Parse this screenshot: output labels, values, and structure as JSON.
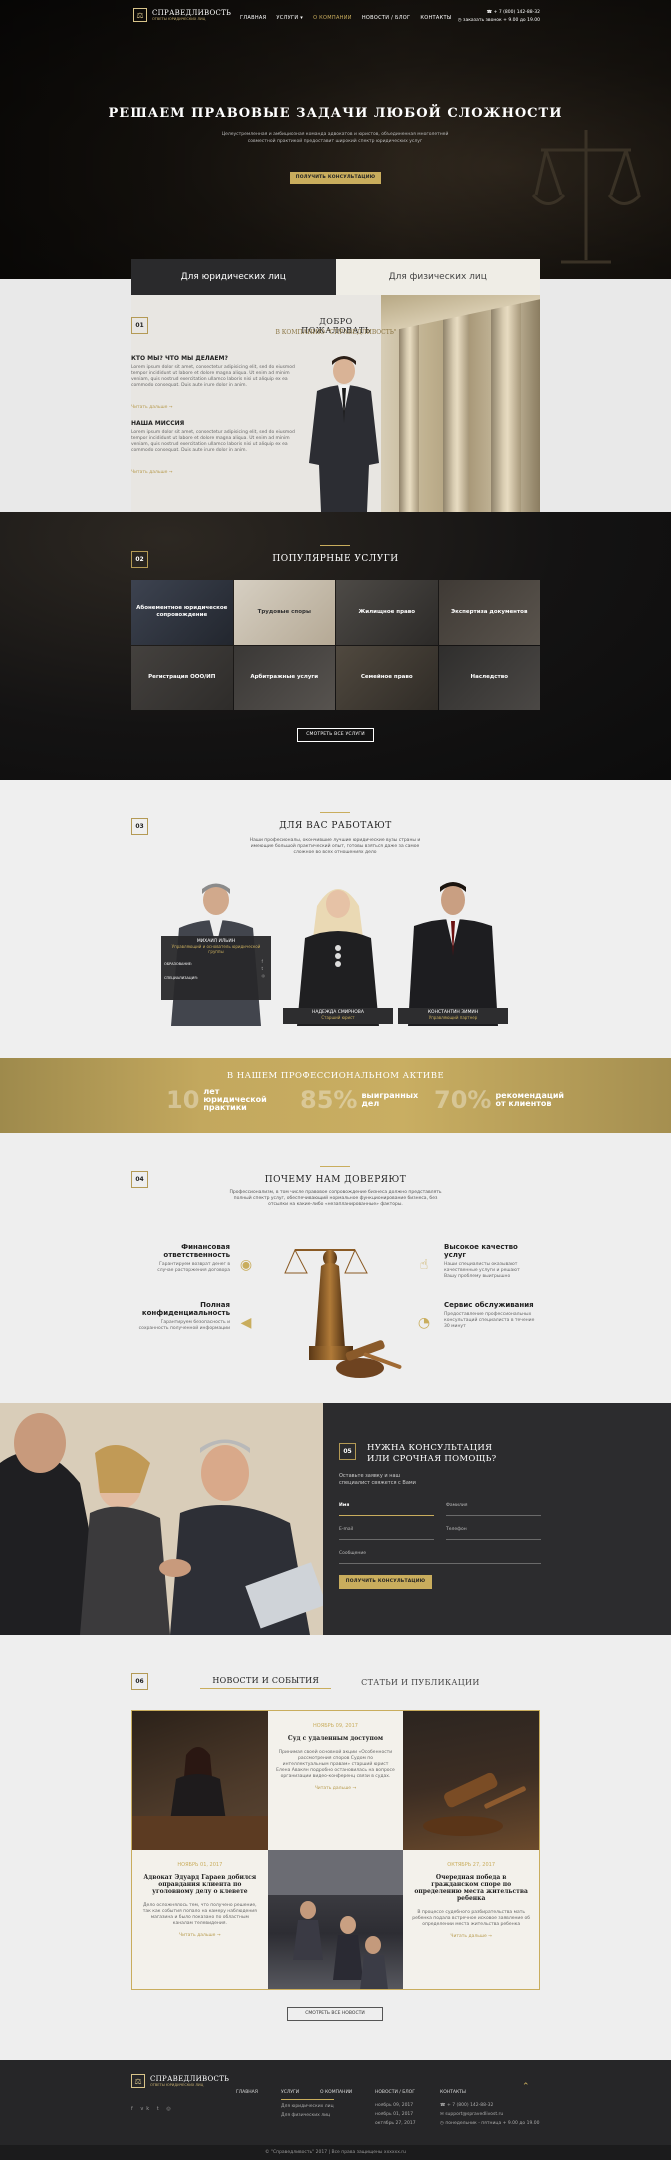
{
  "header": {
    "logo_title": "СПРАВЕДЛИВОСТЬ",
    "logo_subtitle": "ОТВЕТЫ ЮРИДИЧЕСКИХ ЛИЦ",
    "nav": [
      "ГЛАВНАЯ",
      "УСЛУГИ",
      "О КОМПАНИИ",
      "НОВОСТИ / БЛОГ",
      "КОНТАКТЫ"
    ],
    "phone": "+ 7 (800) 142-88-32",
    "hours": "заказать звонок + 9.00 до 19.00"
  },
  "hero": {
    "title": "РЕШАЕМ ПРАВОВЫЕ ЗАДАЧИ ЛЮБОЙ СЛОЖНОСТИ",
    "subtitle": "Целеустремленная и амбициозная команда адвокатов и юристов, объединенная многолетней совместной практикой предоставит широкий спектр юридических услуг",
    "cta": "ПОЛУЧИТЬ КОНСУЛЬТАЦИЮ"
  },
  "tabs": [
    "Для юридических лиц",
    "Для физических лиц"
  ],
  "welcome": {
    "num": "01",
    "title": "ДОБРО ПОЖАЛОВАТЬ",
    "subtitle": "В КОМПАНИЮ \"СПРАВЕДЛИВОСТЬ\"",
    "h1": "КТО МЫ? ЧТО МЫ ДЕЛАЕМ?",
    "p1": "Lorem ipsum dolor sit amet, consectetur adipisicing elit, sed do eiusmod tempor incididunt ut labore et dolore magna aliqua. Ut enim ad minim veniam, quis nostrud exercitation ullamco laboris nisi ut aliquip ex ea commodo consequat. Duis aute irure dolor in anim.",
    "more1": "Читать дальше →",
    "h2": "НАША МИССИЯ",
    "p2": "Lorem ipsum dolor sit amet, consectetur adipisicing elit, sed do eiusmod tempor incididunt ut labore et dolore magna aliqua. Ut enim ad minim veniam, quis nostrud exercitation ullamco laboris nisi ut aliquip ex ea commodo consequat. Duis aute irure dolor in anim.",
    "more2": "Читать дальше →"
  },
  "services": {
    "num": "02",
    "title": "ПОПУЛЯРНЫЕ УСЛУГИ",
    "items": [
      "Абонементное юридическое сопровождение",
      "Трудовые споры",
      "Жилищное право",
      "Экспертиза документов",
      "Регистрация ООО/ИП",
      "Арбитражные услуги",
      "Семейное право",
      "Наследство"
    ],
    "button": "СМОТРЕТЬ ВСЕ УСЛУГИ"
  },
  "team": {
    "num": "03",
    "title": "ДЛЯ ВАС РАБОТАЮТ",
    "desc": "Наши професионалы, окончившие лучшие юридические вузы страны и имеющие большой практический опыт, готовы взяться даже за самое сложное во всех отношениях дело",
    "members": [
      {
        "name": "МИХАИЛ ИЛЬИН",
        "role": "Управляющий и основатель юридической группы"
      },
      {
        "name": "НАДЕЖДА СМИРНОВА",
        "role": "Старший юрист"
      },
      {
        "name": "КОНСТАНТИН ЗИМИН",
        "role": "Управляющий партнер"
      }
    ],
    "card_edu": "ОБРАЗОВАНИЕ:",
    "card_spec": "СПЕЦИАЛИЗАЦИЯ:"
  },
  "stats": {
    "title": "В НАШЕМ ПРОФЕССИОНАЛЬНОМ АКТИВЕ",
    "items": [
      {
        "num": "10",
        "label": "лет юридической практики"
      },
      {
        "num": "85%",
        "label": "выигранных дел"
      },
      {
        "num": "70%",
        "label": "рекомендаций от клиентов"
      }
    ]
  },
  "trust": {
    "num": "04",
    "title": "ПОЧЕМУ НАМ ДОВЕРЯЮТ",
    "desc": "Профессионализм, в том числе правовое сопровождение бизнеса должно представлять полный спектр услуг, обеспечивающий нормальное функционирование бизнеса, без отсылки на какие-либо «незапланированные» факторы.",
    "items": [
      {
        "title": "Финансовая ответственность",
        "text": "Гарантируем возврат денег в случае расторжения договора"
      },
      {
        "title": "Полная конфиденциальность",
        "text": "Гарантируем безопасность и сохранность полученной информации"
      },
      {
        "title": "Высокое качество услуг",
        "text": "Наши специалисты оказывают качественные услуги и решают Вашу проблему выигрышно"
      },
      {
        "title": "Сервис обслуживания",
        "text": "Предоставление профессиональных консультаций специалиста в течение 30 минут"
      }
    ]
  },
  "consult": {
    "num": "05",
    "title": "НУЖНА КОНСУЛЬТАЦИЯ ИЛИ СРОЧНАЯ ПОМОЩЬ?",
    "desc": "Оставьте заявку и наш специалист свяжется с Вами",
    "fields": [
      "Имя",
      "Фамилия",
      "E-mail",
      "Телефон",
      "Сообщение"
    ],
    "button": "ПОЛУЧИТЬ КОНСУЛЬТАЦИЮ"
  },
  "news": {
    "num": "06",
    "tab1": "НОВОСТИ И СОБЫТИЯ",
    "tab2": "СТАТЬИ И ПУБЛИКАЦИИ",
    "items": [
      {
        "date": "НОЯБРЬ 09, 2017",
        "title": "Суд с удаленным доступом",
        "text": "Принимая своей основной акции «Особенности рассмотрения споров Судом по интеллектуальным правам» старший юрист Елена Авакян подробно остановилась на вопросе организации видео-конференц связи в судах.",
        "more": "Читать дальше →"
      },
      {
        "date": "НОЯБРЬ 01, 2017",
        "title": "Адвокат Эдуард Гараев добился оправдания клиента по уголовному делу о клевете",
        "text": "Дело осложнялось тем, что получено решение, так как события попало на камеру наблюдения магазина и было показано по областным каналам телевидения.",
        "more": "Читать дальше →"
      },
      {
        "date": "ОКТЯБРЬ 27, 2017",
        "title": "Очередная победа в гражданском споре по определению места жительства ребенка",
        "text": "В процессе судебного разбирательства мать ребенка подала встречное исковое заявление об определении места жительства ребенка",
        "more": "Читать дальше →"
      }
    ],
    "button": "СМОТРЕТЬ ВСЕ НОВОСТИ"
  },
  "footer": {
    "logo_title": "СПРАВЕДЛИВОСТЬ",
    "logo_subtitle": "ОТВЕТЫ ЮРИДИЧЕСКИХ ЛИЦ",
    "nav": [
      "ГЛАВНАЯ",
      "УСЛУГИ",
      "О КОМПАНИИ",
      "НОВОСТИ / БЛОГ",
      "КОНТАКТЫ"
    ],
    "services": [
      "Для юридических лиц",
      "Для физических лиц"
    ],
    "news": [
      "ноябрь 09, 2017",
      "ноябрь 01, 2017",
      "октябрь 27, 2017"
    ],
    "phone": "+ 7 (800) 142-88-32",
    "email": "support@spravedlivost.ru",
    "hours": "понедельник - пятница + 9.00 до 19.00",
    "copyright": "© \"Справедливость\" 2017 | Все права защищены xxxxxx.ru"
  }
}
